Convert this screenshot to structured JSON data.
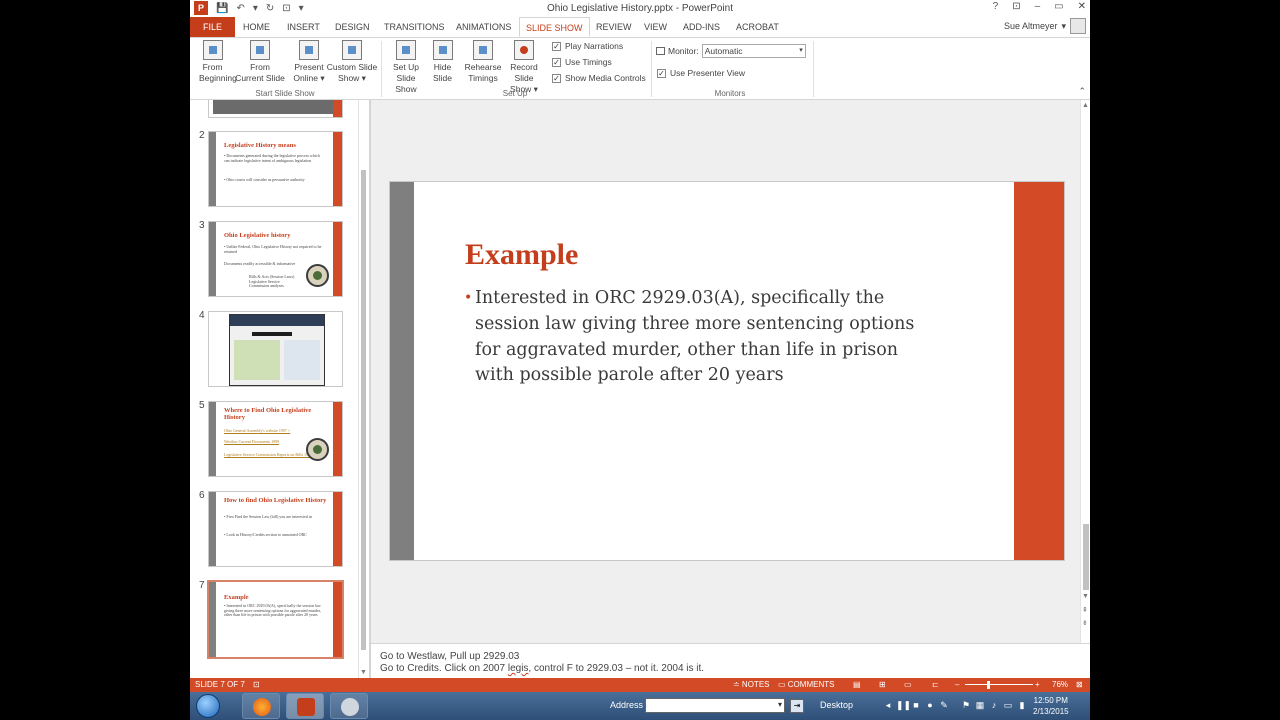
{
  "window": {
    "title": "Ohio Legislative History.pptx - PowerPoint",
    "help": "?",
    "minimize": "–",
    "restore": "▭",
    "close": "✕",
    "ribbon_display": "⊡"
  },
  "qat": {
    "logo": "P",
    "save": "💾",
    "undo": "↶",
    "undo_drop": "▾",
    "redo": "↻",
    "present": "⊡",
    "customize": "▾"
  },
  "user": {
    "name": "Sue Altmeyer",
    "dropdown": "▾"
  },
  "tabs": [
    {
      "label": "FILE"
    },
    {
      "label": "HOME"
    },
    {
      "label": "INSERT"
    },
    {
      "label": "DESIGN"
    },
    {
      "label": "TRANSITIONS"
    },
    {
      "label": "ANIMATIONS"
    },
    {
      "label": "SLIDE SHOW"
    },
    {
      "label": "REVIEW"
    },
    {
      "label": "VIEW"
    },
    {
      "label": "ADD-INS"
    },
    {
      "label": "ACROBAT"
    }
  ],
  "ribbon": {
    "start_group": {
      "label": "Start Slide Show",
      "from_beginning": [
        "From",
        "Beginning"
      ],
      "from_current": [
        "From",
        "Current Slide"
      ],
      "present_online": [
        "Present",
        "Online ▾"
      ],
      "custom_show": [
        "Custom Slide",
        "Show ▾"
      ]
    },
    "setup_group": {
      "label": "Set Up",
      "setup_show": [
        "Set Up",
        "Slide Show"
      ],
      "hide_slide": [
        "Hide",
        "Slide"
      ],
      "rehearse": [
        "Rehearse",
        "Timings"
      ],
      "record": [
        "Record Slide",
        "Show ▾"
      ],
      "play_narrations": "Play Narrations",
      "use_timings": "Use Timings",
      "show_media_controls": "Show Media Controls",
      "check": "✓"
    },
    "monitors_group": {
      "label": "Monitors",
      "monitor_label": "Monitor:",
      "monitor_value": "Automatic",
      "presenter_view": "Use Presenter View",
      "collapse": "⌃"
    }
  },
  "thumbnails": [
    {
      "num": "2",
      "title": "Legislative History means",
      "lines": [
        "• Documents generated during the legislative process which can indicate legislative intent of ambiguous legislation",
        "• Ohio courts will consider as persuasive authority"
      ]
    },
    {
      "num": "3",
      "title": "Ohio Legislative history",
      "lines": [
        "• Unlike Federal, Ohio Legislative History not required to be retained",
        "Documents readily accessible & informative",
        "Bills & Acts (Session Laws) Legislative Service Commission analyses"
      ]
    },
    {
      "num": "4"
    },
    {
      "num": "5",
      "title": "Where to Find Ohio Legislative History",
      "lines": [
        "Ohio General Assembly's website 1997 +",
        "Westlaw Current Documents 1999",
        "Legislative Service Commission Reports on Bills 1991"
      ]
    },
    {
      "num": "6",
      "title": "How to find Ohio Legislative History",
      "lines": [
        "• First Find the Session Law (bill) you are interested in",
        "• Look in History/Credits section to annotated ORC"
      ]
    },
    {
      "num": "7",
      "title": "Example",
      "lines": [
        "• Interested in ORC 2929.03(A), specifically the session law giving three more sentencing options for aggravated murder, other than life in prison with possible parole after 20 years"
      ]
    }
  ],
  "slide": {
    "title": "Example",
    "bullet": "•",
    "body": "Interested in ORC 2929.03(A), specifically the session law giving three more sentencing options for aggravated murder, other than life in prison with possible parole after 20 years"
  },
  "notes": {
    "line1": "Go to Westlaw, Pull up 2929.03",
    "line2_a": "Go to Credits.  Click on 2007 ",
    "line2_sq": "legis",
    "line2_b": ", control F to 2929.03 – not it.  2004 is it."
  },
  "status": {
    "slide_counter": "SLIDE 7 OF 7",
    "notes": "≐ NOTES",
    "comments": "▭ COMMENTS",
    "zoom_minus": "–",
    "zoom_plus": "+",
    "zoom": "76%"
  },
  "taskbar": {
    "address_label": "Address",
    "desktop": "Desktop",
    "time": "12:50 PM",
    "date": "2/13/2015"
  },
  "colors": {
    "accent": "#d24b26",
    "title": "#c43e1c",
    "gray_bar": "#7f7f7f"
  }
}
